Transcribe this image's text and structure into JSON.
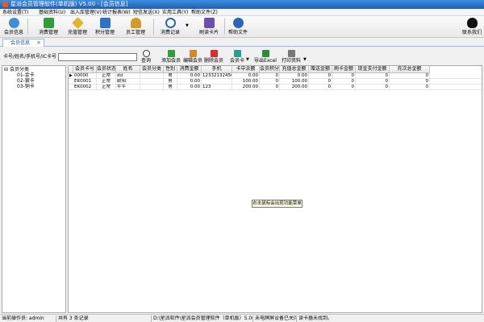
{
  "window": {
    "title": "星派会员管理软件(单机版) V5.00 - [会员信息]"
  },
  "menu": [
    "系统设置(T)",
    "基础资料(U)",
    "出入库管理(V)",
    "统计报表(W)",
    "短信发送(X)",
    "实用工具(Y)",
    "帮助文件(Z)"
  ],
  "toolbar": {
    "member_info": "会员信息",
    "consume": "消费管理",
    "recharge": "充值管理",
    "points": "积分管理",
    "staff": "员工管理",
    "consume_record": "消费记录",
    "read_card": "刷读卡片",
    "help": "帮助文件",
    "contact": "联系我们"
  },
  "tab": {
    "label": "会员信息",
    "close": "×"
  },
  "search": {
    "label": "卡号/姓名/手机号/IC卡号",
    "value": "",
    "button": "查询"
  },
  "actions": {
    "add": "添加会员",
    "edit": "编辑会员",
    "delete": "删除会员",
    "card": "会员卡",
    "export": "导出Excel",
    "print": "打印资料"
  },
  "tree": {
    "root": "会员分类",
    "items": [
      "01-金卡",
      "02-银卡",
      "03-铜卡"
    ]
  },
  "grid": {
    "headers": [
      "会员卡号",
      "会员状态",
      "姓名",
      "会员分类",
      "性别",
      "消费金额",
      "手机",
      "卡中余额",
      "会员积分",
      "充值总金额",
      "赠送金额",
      "刷卡金额",
      "现金支付金额",
      "充次总金额"
    ],
    "rows": [
      [
        "00000",
        "正常",
        "dd",
        "",
        "男",
        "0.00",
        "12332132456",
        "0.00",
        "0",
        "0.00",
        "0",
        "0",
        "0",
        "0"
      ],
      [
        "EK0001",
        "正常",
        "尉阳",
        "",
        "男",
        "0.00",
        "",
        "100.00",
        "0",
        "100.00",
        "0",
        "0",
        "0",
        "0"
      ],
      [
        "EK0002",
        "正常",
        "牛牛",
        "",
        "男",
        "0.00",
        "123",
        "200.00",
        "0",
        "200.00",
        "0",
        "0",
        "0",
        "0"
      ]
    ]
  },
  "tooltip": "右击鼠标会出现功能菜单",
  "status": {
    "operator": "当前操作员: admin",
    "count": "共有 3 条记录",
    "path": "D:\\星派软件\\星派会员管理软件（单机版）5.00\\Memb",
    "reader": "未电牌屏设备已关闭",
    "card": "读卡器未找到。"
  },
  "colors": {
    "title_bar": "#1e5fb5",
    "tab_accent": "#1f4fa8",
    "tooltip_bg": "#ffffe1"
  }
}
